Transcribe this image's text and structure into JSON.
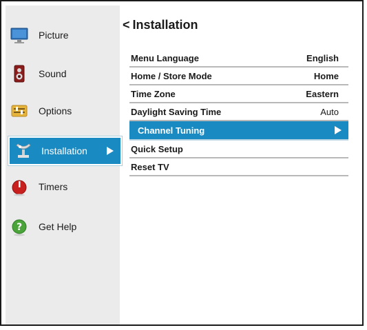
{
  "sidebar": {
    "items": [
      {
        "label": "Picture",
        "icon": "monitor-icon"
      },
      {
        "label": "Sound",
        "icon": "speaker-icon"
      },
      {
        "label": "Options",
        "icon": "options-icon"
      },
      {
        "label": "Installation",
        "icon": "satellite-icon",
        "active": true
      },
      {
        "label": "Timers",
        "icon": "timer-icon"
      },
      {
        "label": "Get Help",
        "icon": "help-icon"
      }
    ]
  },
  "page": {
    "title": "Installation",
    "back_glyph": "<"
  },
  "menu": {
    "rows": [
      {
        "name": "Menu Language",
        "value": "English"
      },
      {
        "name": "Home / Store Mode",
        "value": "Home"
      },
      {
        "name": "Time Zone",
        "value": "Eastern"
      },
      {
        "name": "Daylight Saving Time",
        "value": "Auto"
      },
      {
        "name": "Channel Tuning",
        "value": ""
      },
      {
        "name": "Quick Setup",
        "value": ""
      },
      {
        "name": "Reset TV",
        "value": ""
      }
    ]
  },
  "colors": {
    "accent": "#1a8ac2",
    "sidebar_bg": "#ebebeb",
    "text": "#1a1a1a"
  }
}
